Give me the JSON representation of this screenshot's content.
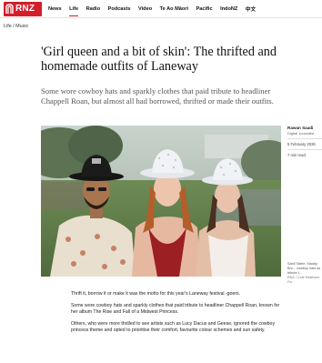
{
  "brand": {
    "logo_text": "RNZ",
    "accent": "#d21f2b"
  },
  "nav": {
    "items": [
      {
        "label": "News",
        "active": false
      },
      {
        "label": "Life",
        "active": true
      },
      {
        "label": "Radio",
        "active": false
      },
      {
        "label": "Podcasts",
        "active": false
      },
      {
        "label": "Video",
        "active": false
      },
      {
        "label": "Te Ao Māori",
        "active": false
      },
      {
        "label": "Pacific",
        "active": false
      },
      {
        "label": "IndoNZ",
        "active": false
      },
      {
        "label": "中文",
        "active": false
      }
    ]
  },
  "breadcrumb": "Life / Music",
  "article": {
    "headline": "'Girl queen and a bit of skin': The thrifted and homemade outfits of Laneway",
    "standfirst": "Some wore cowboy hats and sparkly clothes that paid tribute to headliner Chappell Roan, but almost all had borrowed, thrifted or made their outfits.",
    "byline": {
      "name": "Rawan Saadi",
      "role": "Digital Journalist",
      "date": "5 February 2026",
      "read_time": "7 min read"
    },
    "image": {
      "icon": "photo-people-cowboy-hats",
      "caption": "Sahil Talele, Maddy Bro... cowboy hats as tribute t...",
      "credit": "RNZ / Cole Eastham-Fa..."
    },
    "body": [
      "Thrift it, borrow it or make it was the motto for this year's Laneway festival -goers.",
      "Some wore cowboy hats and sparkly clothes that paid tribute to headliner Chappell Roan, known for her album The Rise and Fall of a Midwest Princess.",
      "Others, who were more thrilled to see artists such as Lucy Dacus and Geese, ignored the cowboy princess theme and opted to prioritise their comfort, favourite colour schemes and sun safety."
    ]
  }
}
